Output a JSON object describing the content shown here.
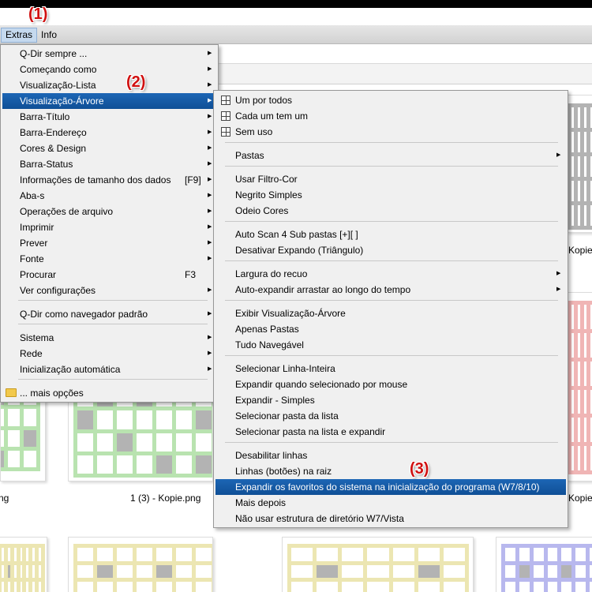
{
  "menubar": {
    "extras": "Extras",
    "info": "Info"
  },
  "badges": [
    "(1)",
    "(2)",
    "(3)"
  ],
  "labels": {
    "kopie_right_top": "Kopie",
    "thumb_mid": "1 (3) - Kopie.png",
    "kopie_right_mid": "Kopie",
    "left_cut": "ng"
  },
  "extras_menu": [
    {
      "label": "Q-Dir sempre ...",
      "arrow": true
    },
    {
      "label": "Começando como",
      "arrow": true
    },
    {
      "label": "Visualização-Lista",
      "arrow": true
    },
    {
      "label": "Visualização-Árvore",
      "arrow": true,
      "highlight": true
    },
    {
      "label": "Barra-Título",
      "arrow": true
    },
    {
      "label": "Barra-Endereço",
      "arrow": true
    },
    {
      "label": "Cores & Design",
      "arrow": true
    },
    {
      "label": "Barra-Status",
      "arrow": true
    },
    {
      "label": "Informações de tamanho dos dados",
      "shortcut": "[F9]",
      "arrow": true
    },
    {
      "label": "Aba-s",
      "arrow": true
    },
    {
      "label": "Operações de arquivo",
      "arrow": true
    },
    {
      "label": "Imprimir",
      "arrow": true
    },
    {
      "label": "Prever",
      "arrow": true
    },
    {
      "label": "Fonte",
      "arrow": true
    },
    {
      "label": "Procurar",
      "shortcut": "F3",
      "arrow": false
    },
    {
      "label": "Ver configurações",
      "arrow": true
    },
    {
      "label": "Q-Dir como navegador padrão",
      "arrow": true
    },
    {
      "label": "Sistema",
      "arrow": true
    },
    {
      "label": "Rede",
      "arrow": true
    },
    {
      "label": "Inicialização automática",
      "arrow": true
    },
    {
      "label": "... mais opções",
      "arrow": false
    }
  ],
  "tree_menu": [
    {
      "label": "Um por todos",
      "icon": "tree-view-icon"
    },
    {
      "label": "Cada um tem um",
      "icon": "tree-view-icon"
    },
    {
      "label": "Sem uso",
      "icon": "tree-view-icon"
    },
    {
      "label": "Pastas",
      "arrow": true
    },
    {
      "label": "Usar Filtro-Cor"
    },
    {
      "label": "Negrito Simples"
    },
    {
      "label": "Odeio Cores"
    },
    {
      "label": "Auto Scan 4 Sub pastas [+][ ]"
    },
    {
      "label": "Desativar Expando (Triângulo)"
    },
    {
      "label": "Largura do recuo",
      "arrow": true
    },
    {
      "label": "Auto-expandir arrastar ao longo do tempo",
      "arrow": true
    },
    {
      "label": "Exibir Visualização-Árvore"
    },
    {
      "label": "Apenas Pastas"
    },
    {
      "label": "Tudo Navegável"
    },
    {
      "label": "Selecionar Linha-Inteira"
    },
    {
      "label": "Expandir quando selecionado por mouse"
    },
    {
      "label": "Expandir - Simples"
    },
    {
      "label": "Selecionar pasta da lista"
    },
    {
      "label": "Selecionar pasta na lista e expandir"
    },
    {
      "label": "Desabilitar linhas"
    },
    {
      "label": "Linhas (botões) na raiz"
    },
    {
      "label": "Expandir os favoritos do sistema na inicialização do programa (W7/8/10)",
      "highlight": true
    },
    {
      "label": "Mais depois"
    },
    {
      "label": "Não usar estrutura de diretório W7/Vista"
    }
  ],
  "colors": {
    "highlight": "#1d66b5",
    "badge": "#d01010",
    "thumb_green": "#b9e3b0",
    "thumb_yellow": "#ece6b2",
    "thumb_blue": "#b8b8ee",
    "thumb_red": "#f0b5b5",
    "thumb_gray": "#b3b3b3"
  }
}
